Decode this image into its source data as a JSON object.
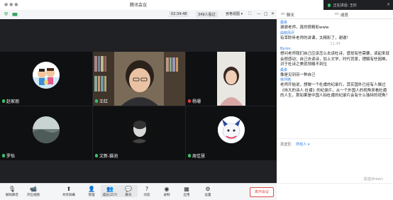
{
  "window": {
    "title": "腾讯会议"
  },
  "speaking": {
    "label": "正在讲话: 王红"
  },
  "toolbar": {
    "timer": "02:34:48",
    "participants": "349人看过",
    "view_mode": "宫格视图"
  },
  "tiles": [
    {
      "name": "赵家朋",
      "mic": "on"
    },
    {
      "name": "王红",
      "mic": "on"
    },
    {
      "name": "杨珊",
      "mic": "off"
    },
    {
      "name": "罗怡",
      "mic": "on"
    },
    {
      "name": "文新-猫池",
      "mic": "on"
    },
    {
      "name": "周佳慧",
      "mic": "on"
    }
  ],
  "panel": {
    "tab_chat": "聊天",
    "tab_members": "成员"
  },
  "chat": {
    "messages": [
      {
        "name": "桑染",
        "text": "谢谢老师，真的很精彩www"
      },
      {
        "name": "由晓风尽",
        "text": "有幸聆听老师的讲课，太精彩了，谢谢！"
      },
      {
        "time": "11:34"
      },
      {
        "name": "Byron.",
        "text": "想问老师我们自己应该怎么去读杜诗，感觉有些需要，读起来就会很感动；自己去读诗，加上文学，时代背景，理解有些困难，对于杜诗之美就领略不到位"
      },
      {
        "name": "桑染",
        "text": "像是见到另一种自己"
      },
      {
        "name": "林坪皓",
        "text": "老师开始说，想做一个杜甫的纪录片。其实国外已经有人做过《伟大的诗人·杜甫》的纪录片，从一个外国人的视角来看杜甫的人生，那如果是中国人拍杜甫的纪录片会有什么独特的视角？"
      }
    ],
    "send_to_label": "发送至:",
    "send_to_value": "所有人",
    "send_hint": "发送(Enter)"
  },
  "bottom_bar": {
    "buttons": [
      "解除静音",
      "开启视频",
      "共享屏幕",
      "管理",
      "成员(257)",
      "聊天",
      "问答",
      "录制",
      "应用",
      "设置"
    ],
    "leave": "离开会议"
  },
  "colors": {
    "accent": "#2c7be5",
    "danger": "#e04a4a",
    "mic_on": "#39c06a"
  }
}
